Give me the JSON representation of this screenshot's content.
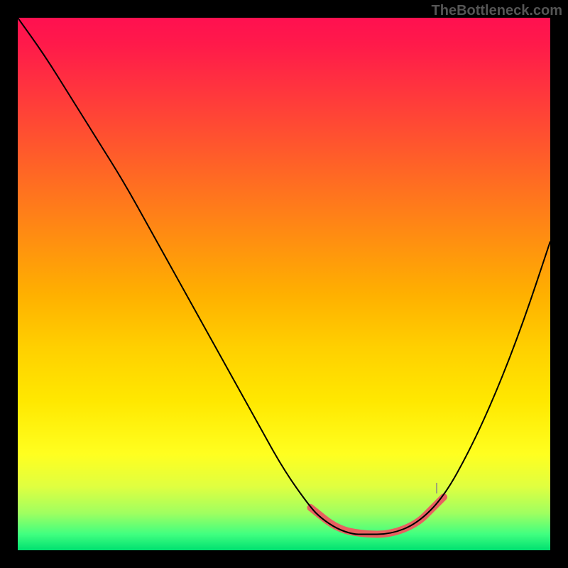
{
  "watermark": "TheBottleneck.com",
  "chart_data": {
    "type": "line",
    "title": "",
    "xlabel": "",
    "ylabel": "",
    "xlim": [
      0,
      100
    ],
    "ylim": [
      0,
      100
    ],
    "series": [
      {
        "name": "main-curve",
        "x": [
          0,
          5,
          10,
          15,
          20,
          25,
          30,
          35,
          40,
          45,
          50,
          55,
          57,
          60,
          63,
          65,
          70,
          75,
          80,
          85,
          90,
          95,
          100
        ],
        "y": [
          100,
          93,
          85,
          77,
          69,
          60,
          51,
          42,
          33,
          24,
          15,
          8,
          6,
          4,
          3,
          3,
          3,
          5,
          10,
          19,
          30,
          43,
          58
        ]
      },
      {
        "name": "highlight-zone",
        "x": [
          55,
          60,
          65,
          70,
          75,
          78,
          80
        ],
        "y": [
          8,
          4,
          3,
          3,
          5,
          8,
          10
        ]
      }
    ],
    "annotations": {
      "description": "V-shaped bottleneck curve over rainbow heat gradient; minimum around x≈67 y≈3; salmon-pink highlight strip along valley floor; short grey hash mark near top of right branch inside valley.",
      "gradient_stops": [
        "#ff1050",
        "#ff9010",
        "#ffe800",
        "#00e070"
      ]
    }
  }
}
